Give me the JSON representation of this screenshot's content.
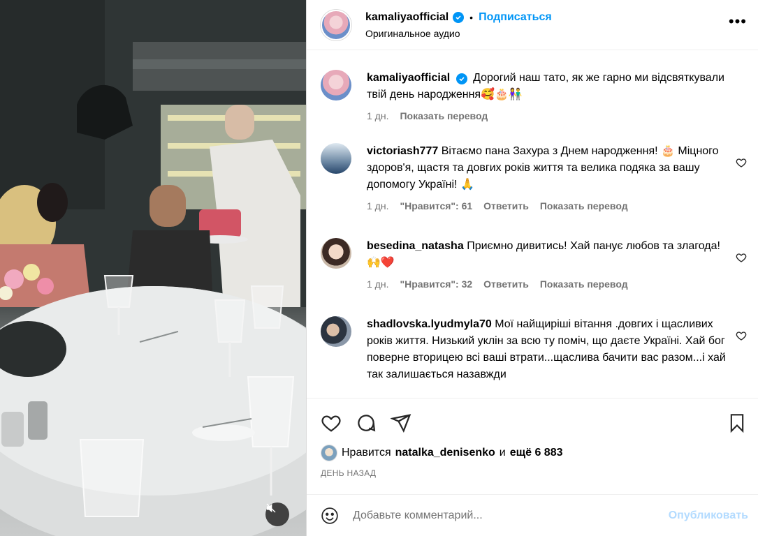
{
  "header": {
    "username": "kamaliyaofficial",
    "separator": "•",
    "follow_label": "Подписаться",
    "audio_label": "Оригинальное аудио",
    "more_label": "•••"
  },
  "caption": {
    "username": "kamaliyaofficial",
    "text": "Дорогий наш тато, як же гарно ми відсвяткували твій день народження🥰🎂👫",
    "time": "1 дн.",
    "translate_label": "Показать перевод"
  },
  "comments": [
    {
      "username": "victoriash777",
      "text": "Вітаємо пана Захура з Днем народження! 🎂 Міцного здоров'я, щастя та довгих років життя та велика подяка за вашу допомогу Україні! 🙏",
      "time": "1 дн.",
      "likes_label": "\"Нравится\": 61",
      "reply_label": "Ответить",
      "translate_label": "Показать перевод"
    },
    {
      "username": "besedina_natasha",
      "text": "Приємно дивитись! Хай панує любов та злагода! 🙌❤️",
      "time": "1 дн.",
      "likes_label": "\"Нравится\": 32",
      "reply_label": "Ответить",
      "translate_label": "Показать перевод"
    },
    {
      "username": "shadlovska.lyudmyla70",
      "text": "Мої найщиріші вітання .довгих і щасливих років життя. Низький уклін за всю ту поміч, що даєте Україні. Хай бог поверне вторицею всі ваші втрати...щаслива бачити вас разом...і хай так залишається назавжди"
    }
  ],
  "likes": {
    "prefix": "Нравится",
    "user": "natalka_denisenko",
    "and": "и",
    "more": "ещё 6 883"
  },
  "date_label": "ДЕНЬ НАЗАД",
  "composer": {
    "placeholder": "Добавьте комментарий...",
    "publish_label": "Опубликовать"
  },
  "icons": [
    "heart-icon",
    "comment-icon",
    "share-icon",
    "bookmark-icon",
    "emoji-icon",
    "mute-icon",
    "verified-icon",
    "more-icon"
  ],
  "colors": {
    "accent": "#0095f6",
    "publish_disabled": "#b3dbff",
    "muted_text": "#737373"
  }
}
